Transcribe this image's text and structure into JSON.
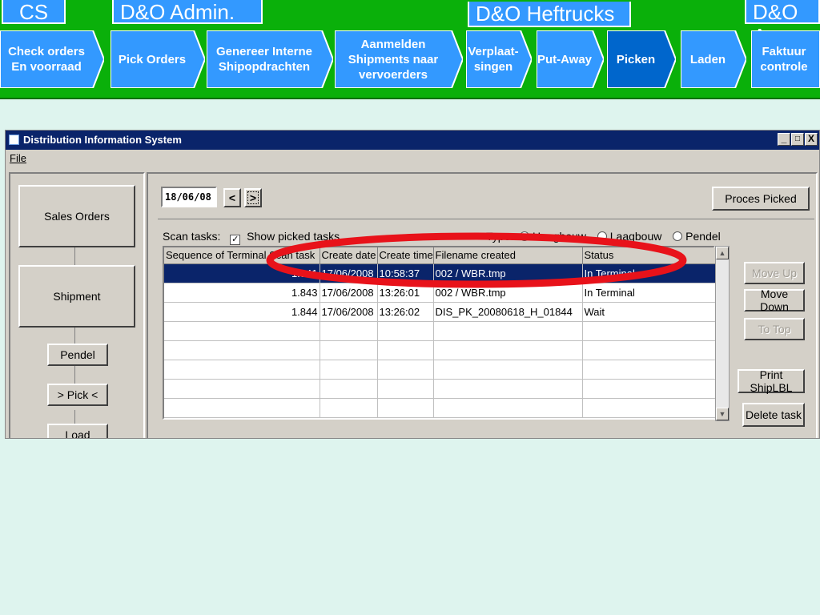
{
  "banner": {
    "sections": [
      "CS",
      "D&O Admin.",
      "D&O Heftrucks",
      "D&O A"
    ],
    "steps": [
      {
        "label": "Check orders En voorraad",
        "active": false
      },
      {
        "label": "Pick Orders",
        "active": false
      },
      {
        "label": "Genereer Interne Shipopdrachten",
        "active": false
      },
      {
        "label": "Aanmelden Shipments naar vervoerders",
        "active": false
      },
      {
        "label": "Verplaat- singen",
        "active": false
      },
      {
        "label": "Put-Away",
        "active": false
      },
      {
        "label": "Picken",
        "active": true
      },
      {
        "label": "Laden",
        "active": false
      },
      {
        "label": "Faktuur controle",
        "active": false
      }
    ],
    "colors": {
      "green": "#0ab00a",
      "step": "#3399ff",
      "active": "#0066cc"
    }
  },
  "window": {
    "title": "Distribution Information System",
    "menu": [
      "File"
    ],
    "controls": [
      "_",
      "□",
      "X"
    ]
  },
  "left_panel": {
    "buttons": [
      "Sales Orders",
      "Shipment",
      "Pendel",
      "> Pick <",
      "Load"
    ]
  },
  "toolbar": {
    "date": "18/06/08",
    "prev": "<",
    "next": ">",
    "process_button": "Proces Picked"
  },
  "scan_tasks": {
    "label": "Scan tasks:",
    "show_picked_label": "Show picked tasks",
    "show_picked_checked": true,
    "type_label": "Type:",
    "type_options": [
      "Hoogbouw",
      "Laagbouw",
      "Pendel"
    ],
    "type_selected": "Hoogbouw"
  },
  "table": {
    "columns": [
      "Sequence of Terminal Scan task",
      "Create date",
      "Create time",
      "Filename created",
      "Status"
    ],
    "rows": [
      {
        "seq": "1.841",
        "date": "17/06/2008",
        "time": "10:58:37",
        "file": "002 / WBR.tmp",
        "status": "In Terminal",
        "selected": true
      },
      {
        "seq": "1.843",
        "date": "17/06/2008",
        "time": "13:26:01",
        "file": "002 / WBR.tmp",
        "status": "In Terminal",
        "selected": false
      },
      {
        "seq": "1.844",
        "date": "17/06/2008",
        "time": "13:26:02",
        "file": "DIS_PK_20080618_H_01844",
        "status": "Wait",
        "selected": false
      }
    ],
    "empty_rows": 5
  },
  "side_buttons": {
    "move_up": "Move Up",
    "move_down": "Move Down",
    "to_top": "To Top",
    "print": "Print ShipLBL",
    "delete": "Delete task"
  },
  "highlight_color": "#e8121a"
}
